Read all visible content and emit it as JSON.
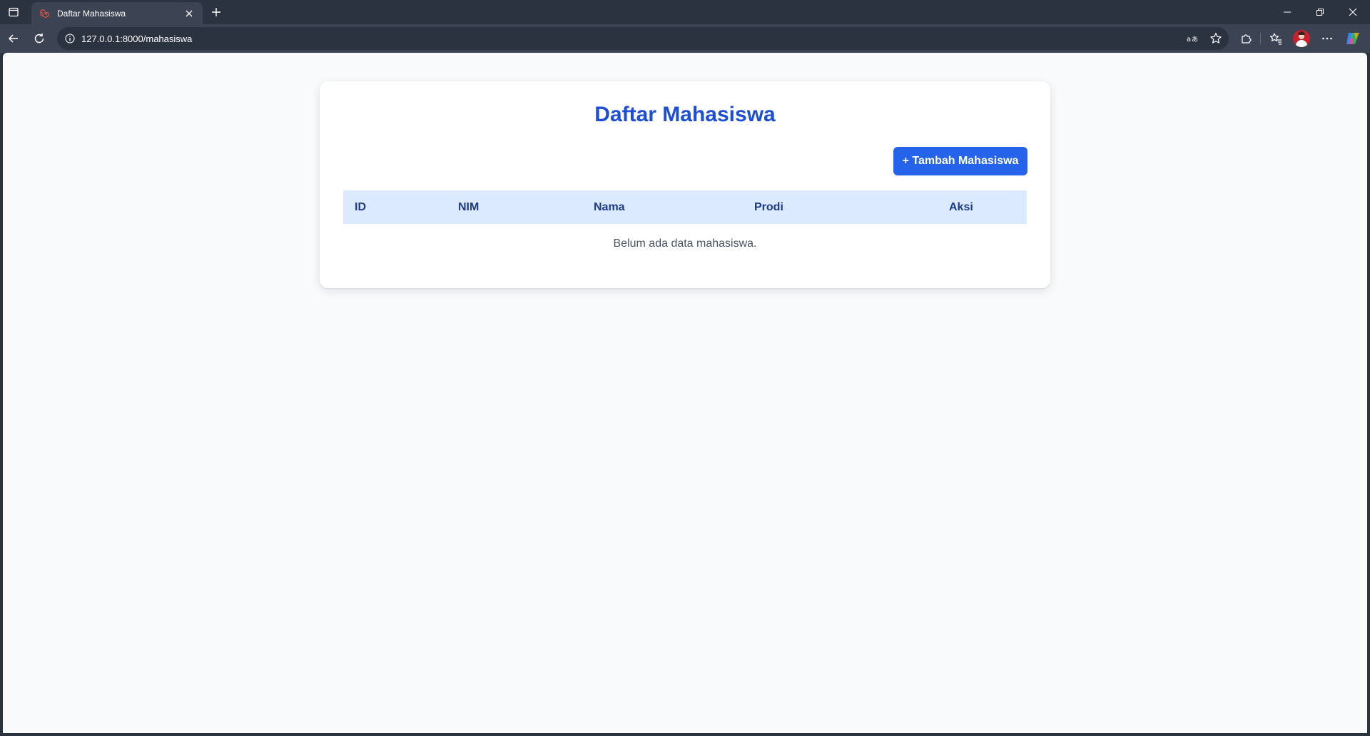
{
  "browser": {
    "tab": {
      "title": "Daftar Mahasiswa"
    },
    "address_bar": {
      "url": "127.0.0.1:8000/mahasiswa"
    },
    "icons": [
      "tab-actions-icon",
      "laravel-icon",
      "close-icon",
      "plus-icon",
      "minimize-icon",
      "restore-icon",
      "window-close-icon",
      "back-icon",
      "refresh-icon",
      "info-icon",
      "read-aloud-icon",
      "star-icon",
      "extensions-icon",
      "favorites-icon",
      "more-icon",
      "copilot-icon"
    ]
  },
  "page": {
    "title": "Daftar Mahasiswa",
    "add_button_label": "+ Tambah Mahasiswa",
    "table": {
      "columns": [
        "ID",
        "NIM",
        "Nama",
        "Prodi",
        "Aksi"
      ],
      "rows": [],
      "empty_message": "Belum ada data mahasiswa."
    }
  },
  "colors": {
    "primary": "#2563eb",
    "heading": "#1d4ed8",
    "table_header_bg": "#dbeafe",
    "table_header_text": "#1e3a8a",
    "page_bg": "#f8fafc",
    "browser_chrome": "#2b3240"
  }
}
